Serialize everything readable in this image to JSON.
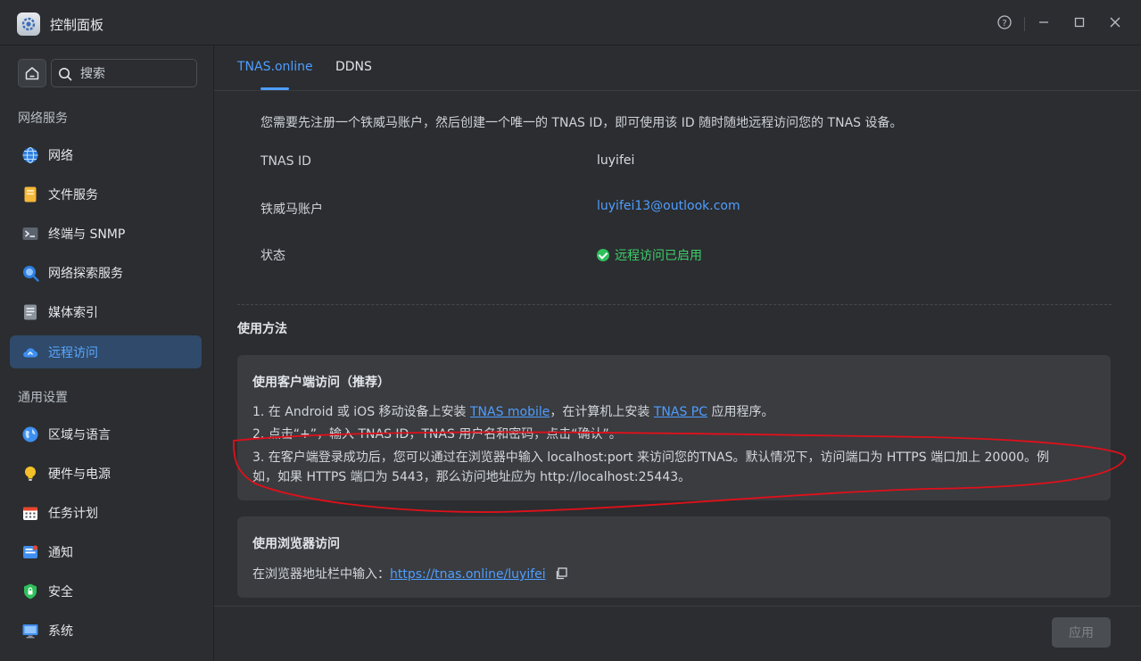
{
  "window": {
    "title": "控制面板"
  },
  "sidebar": {
    "search_placeholder": "搜索",
    "groups": [
      {
        "title": "网络服务",
        "items": [
          {
            "label": "网络",
            "icon": "globe-icon"
          },
          {
            "label": "文件服务",
            "icon": "folder-icon"
          },
          {
            "label": "终端与 SNMP",
            "icon": "terminal-icon"
          },
          {
            "label": "网络探索服务",
            "icon": "discovery-icon"
          },
          {
            "label": "媒体索引",
            "icon": "media-index-icon"
          },
          {
            "label": "远程访问",
            "icon": "cloud-icon",
            "active": true
          }
        ]
      },
      {
        "title": "通用设置",
        "items": [
          {
            "label": "区域与语言",
            "icon": "region-icon"
          },
          {
            "label": "硬件与电源",
            "icon": "bulb-icon"
          },
          {
            "label": "任务计划",
            "icon": "calendar-icon"
          },
          {
            "label": "通知",
            "icon": "notification-icon"
          },
          {
            "label": "安全",
            "icon": "shield-icon"
          },
          {
            "label": "系统",
            "icon": "monitor-icon"
          }
        ]
      }
    ]
  },
  "tabs": [
    {
      "label": "TNAS.online",
      "active": true
    },
    {
      "label": "DDNS",
      "active": false
    }
  ],
  "main": {
    "intro": "您需要先注册一个铁威马账户，然后创建一个唯一的 TNAS ID，即可使用该 ID 随时随地远程访问您的 TNAS 设备。",
    "info": {
      "tnas_id_label": "TNAS ID",
      "tnas_id_value": "luyifei",
      "account_label": "铁威马账户",
      "account_value": "luyifei13@outlook.com",
      "status_label": "状态",
      "status_value": "远程访问已启用"
    },
    "usage_title": "使用方法",
    "client_card": {
      "title": "使用客户端访问（推荐）",
      "step1_a": "1. 在 Android 或 iOS 移动设备上安装 ",
      "step1_link1": "TNAS mobile",
      "step1_b": "，在计算机上安装 ",
      "step1_link2": "TNAS PC",
      "step1_c": " 应用程序。",
      "step2": "2. 点击“+”，输入 TNAS ID，TNAS 用户名和密码，点击“确认”。",
      "step3_line1": "3. 在客户端登录成功后，您可以通过在浏览器中输入 localhost:port 来访问您的TNAS。默认情况下，访问端口为 HTTPS 端口加上 20000。例",
      "step3_line2": "如，如果 HTTPS 端口为 5443，那么访问地址应为 http://localhost:25443。"
    },
    "browser_card": {
      "title": "使用浏览器访问",
      "prefix": "在浏览器地址栏中输入：",
      "url": "https://tnas.online/luyifei"
    },
    "apply_label": "应用"
  },
  "colors": {
    "accent": "#4f9eff",
    "status_ok": "#3ccf6a",
    "annotation": "#e0101a"
  }
}
